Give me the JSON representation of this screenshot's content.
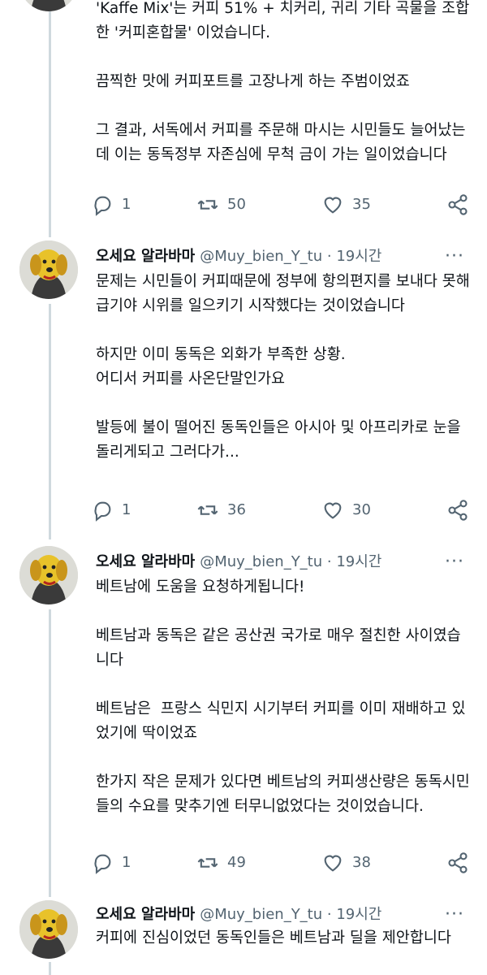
{
  "tweets": [
    {
      "name": "",
      "handle": "",
      "paragraphs": [
        "'Kaffe Mix'는 커피 51% + 치커리, 귀리 기타 곡물을 조합한 '커피혼합물' 이었습니다.",
        "끔찍한 맛에 커피포트를 고장나게 하는 주범이었죠",
        "그 결과, 서독에서 커피를 주문해 마시는 시민들도 늘어났는데 이는 동독정부 자존심에 무척 금이 가는 일이었습니다"
      ],
      "replies": "1",
      "retweets": "50",
      "likes": "35"
    },
    {
      "name": "오세요 알라바마",
      "handle": "@Muy_bien_Y_tu · 19시간",
      "paragraphs": [
        "문제는 시민들이 커피때문에 정부에 항의편지를 보내다 못해 급기야 시위를 일으키기 시작했다는 것이었습니다",
        "하지만 이미 동독은 외화가 부족한 상황.\n어디서 커피를 사온단말인가요",
        "발등에 불이 떨어진 동독인들은 아시아 및 아프리카로 눈을 돌리게되고 그러다가..."
      ],
      "replies": "1",
      "retweets": "36",
      "likes": "30"
    },
    {
      "name": "오세요 알라바마",
      "handle": "@Muy_bien_Y_tu · 19시간",
      "paragraphs": [
        "베트남에 도움을 요청하게됩니다!",
        "베트남과 동독은 같은 공산권 국가로 매우 절친한 사이였습니다",
        "베트남은  프랑스 식민지 시기부터 커피를 이미 재배하고 있었기에 딱이었죠",
        "한가지 작은 문제가 있다면 베트남의 커피생산량은 동독시민들의 수요를 맞추기엔 터무니없었다는 것이었습니다."
      ],
      "replies": "1",
      "retweets": "49",
      "likes": "38"
    },
    {
      "name": "오세요 알라바마",
      "handle": "@Muy_bien_Y_tu · 19시간",
      "paragraphs": [
        "커피에 진심이었던 동독인들은 베트남과 딜을 제안합니다"
      ]
    }
  ],
  "more_label": "···",
  "icons": [
    "reply-icon",
    "retweet-icon",
    "like-icon",
    "share-icon",
    "more-icon"
  ],
  "colors": {
    "text": "#0f1419",
    "muted": "#536471",
    "thread_line": "#cfd9de"
  }
}
